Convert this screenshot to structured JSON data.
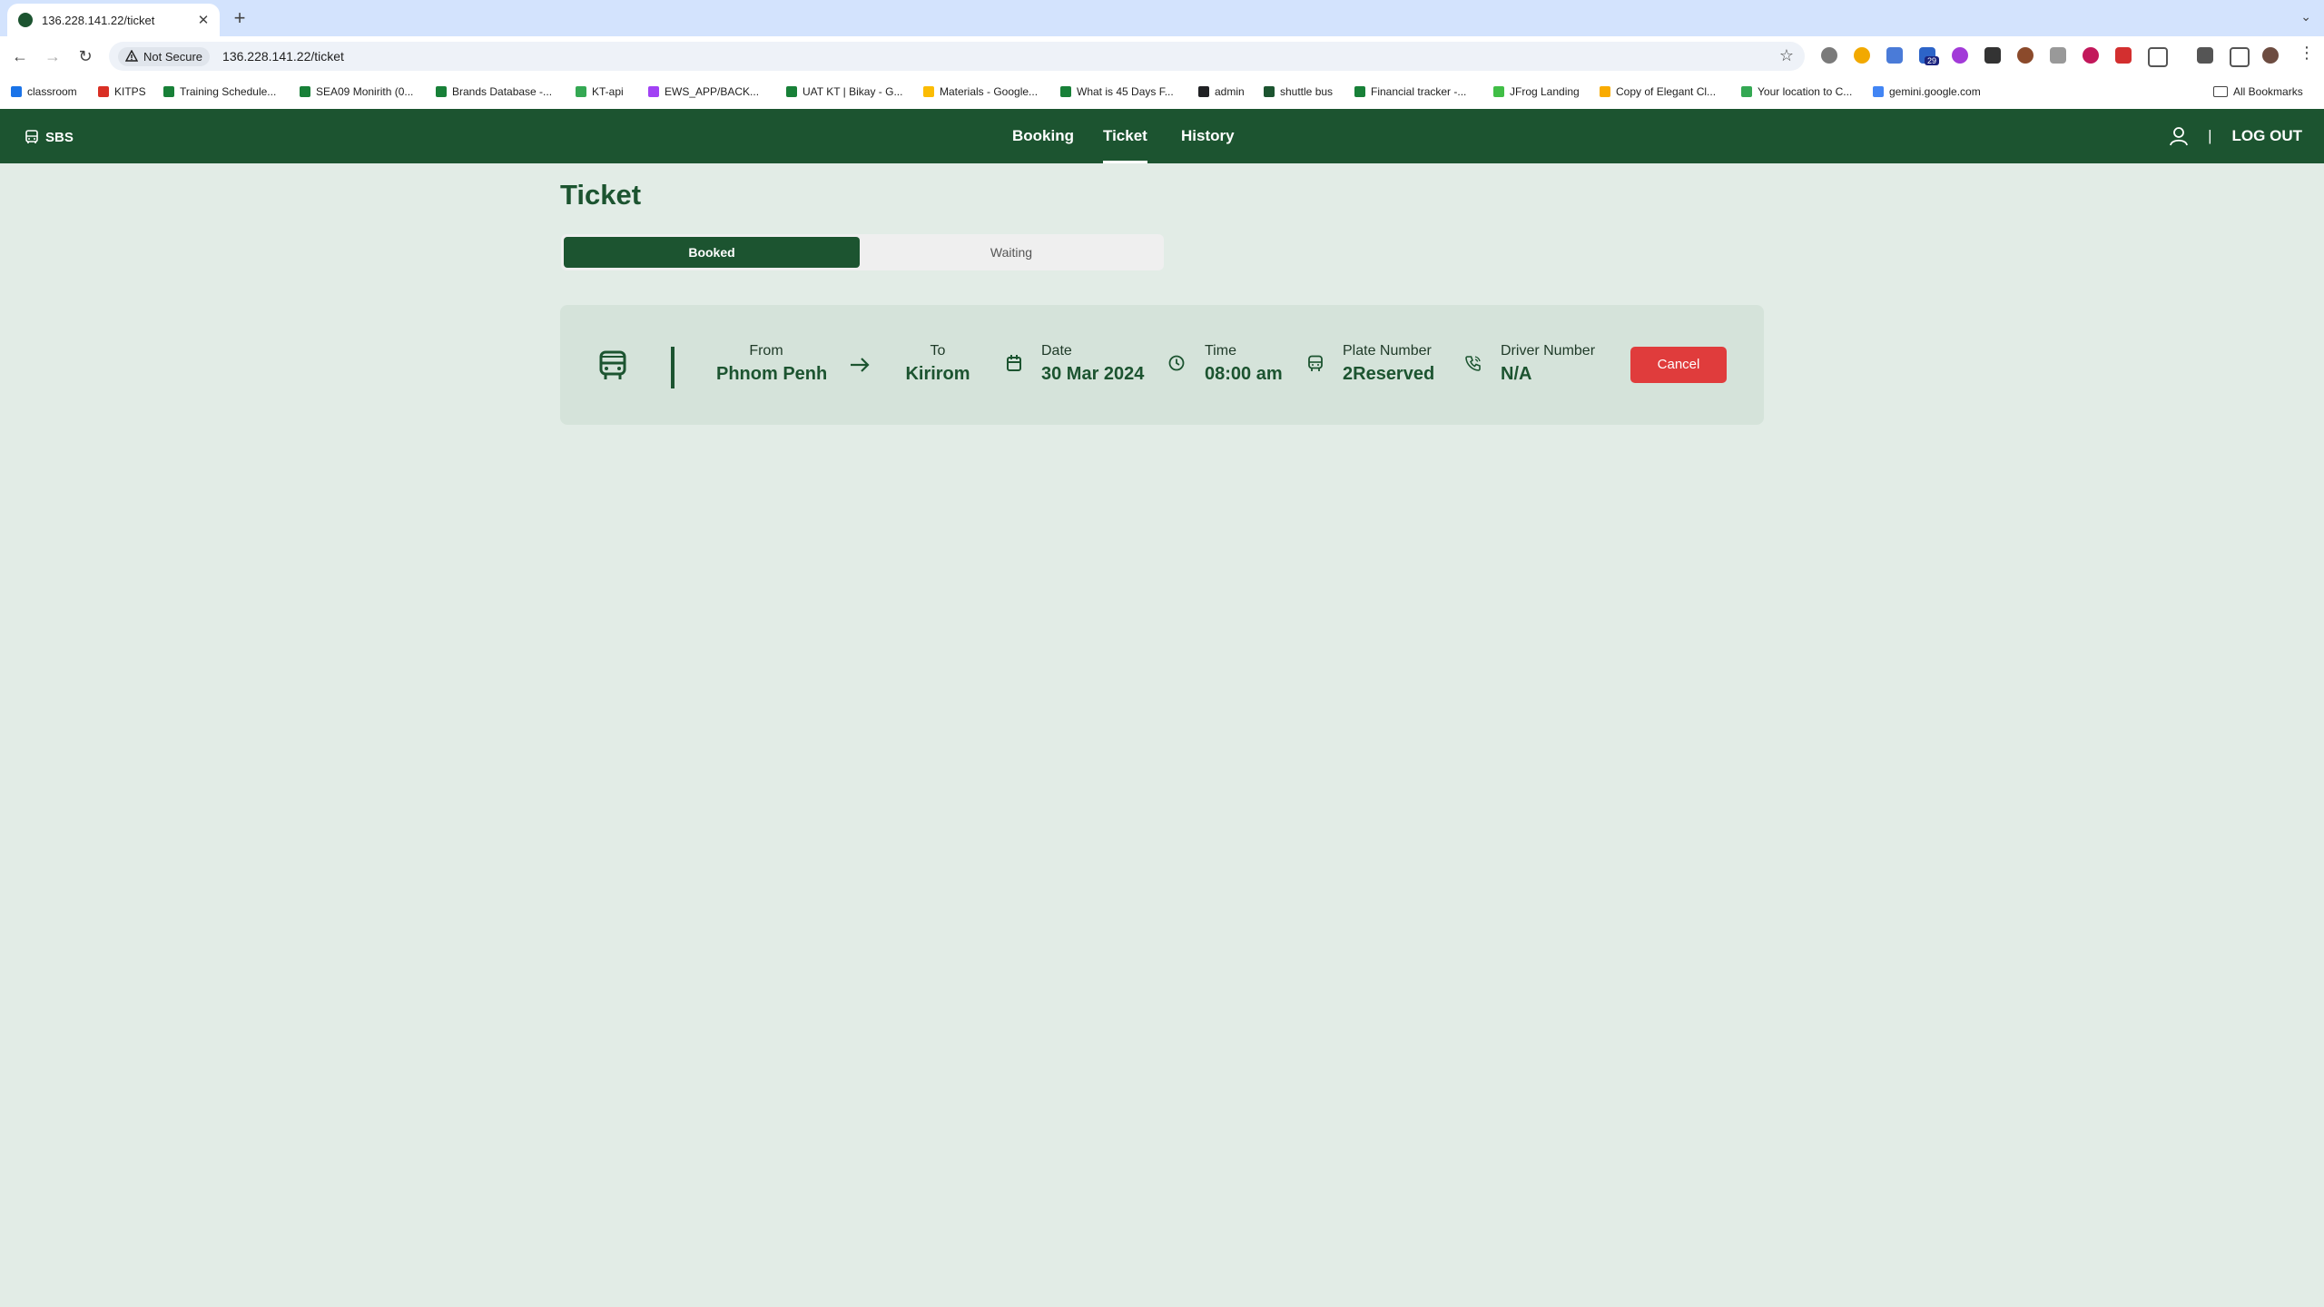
{
  "browser": {
    "tab_title": "136.228.141.22/ticket",
    "new_tab": "+",
    "security_label": "Not Secure",
    "url": "136.228.141.22/ticket",
    "bookmarks": [
      {
        "label": "classroom",
        "color": "#1a73e8"
      },
      {
        "label": "KITPS",
        "color": "#d93025"
      },
      {
        "label": "Training Schedule...",
        "color": "#188038"
      },
      {
        "label": "SEA09 Monirith (0...",
        "color": "#188038"
      },
      {
        "label": "Brands Database -...",
        "color": "#188038"
      },
      {
        "label": "KT-api",
        "color": "#34a853"
      },
      {
        "label": "EWS_APP/BACK...",
        "color": "#a142f4"
      },
      {
        "label": "UAT KT | Bikay - G...",
        "color": "#188038"
      },
      {
        "label": "Materials - Google...",
        "color": "#fbbc04"
      },
      {
        "label": "What is 45 Days F...",
        "color": "#188038"
      },
      {
        "label": "admin",
        "color": "#202124"
      },
      {
        "label": "shuttle bus",
        "color": "#1c5430"
      },
      {
        "label": "Financial tracker -...",
        "color": "#188038"
      },
      {
        "label": "JFrog Landing",
        "color": "#40be46"
      },
      {
        "label": "Copy of Elegant Cl...",
        "color": "#f9ab00"
      },
      {
        "label": "Your location to C...",
        "color": "#34a853"
      },
      {
        "label": "gemini.google.com",
        "color": "#4285f4"
      }
    ],
    "all_bookmarks": "All Bookmarks",
    "extension_badge": "29"
  },
  "app": {
    "logo_text": "SBS",
    "nav": {
      "booking": "Booking",
      "ticket": "Ticket",
      "history": "History"
    },
    "separator": "|",
    "logout": "LOG OUT",
    "page_title": "Ticket",
    "tabs": {
      "booked": "Booked",
      "waiting": "Waiting"
    },
    "ticket": {
      "from_label": "From",
      "from_value": "Phnom Penh",
      "to_label": "To",
      "to_value": "Kirirom",
      "date_label": "Date",
      "date_value": "30 Mar 2024",
      "time_label": "Time",
      "time_value": "08:00 am",
      "plate_label": "Plate Number",
      "plate_value": "2Reserved",
      "driver_label": "Driver Number",
      "driver_value": "N/A",
      "cancel_label": "Cancel"
    },
    "colors": {
      "primary": "#1c5430",
      "background": "#e2ece6",
      "card": "#d5e3da",
      "danger": "#e03c3c"
    }
  }
}
